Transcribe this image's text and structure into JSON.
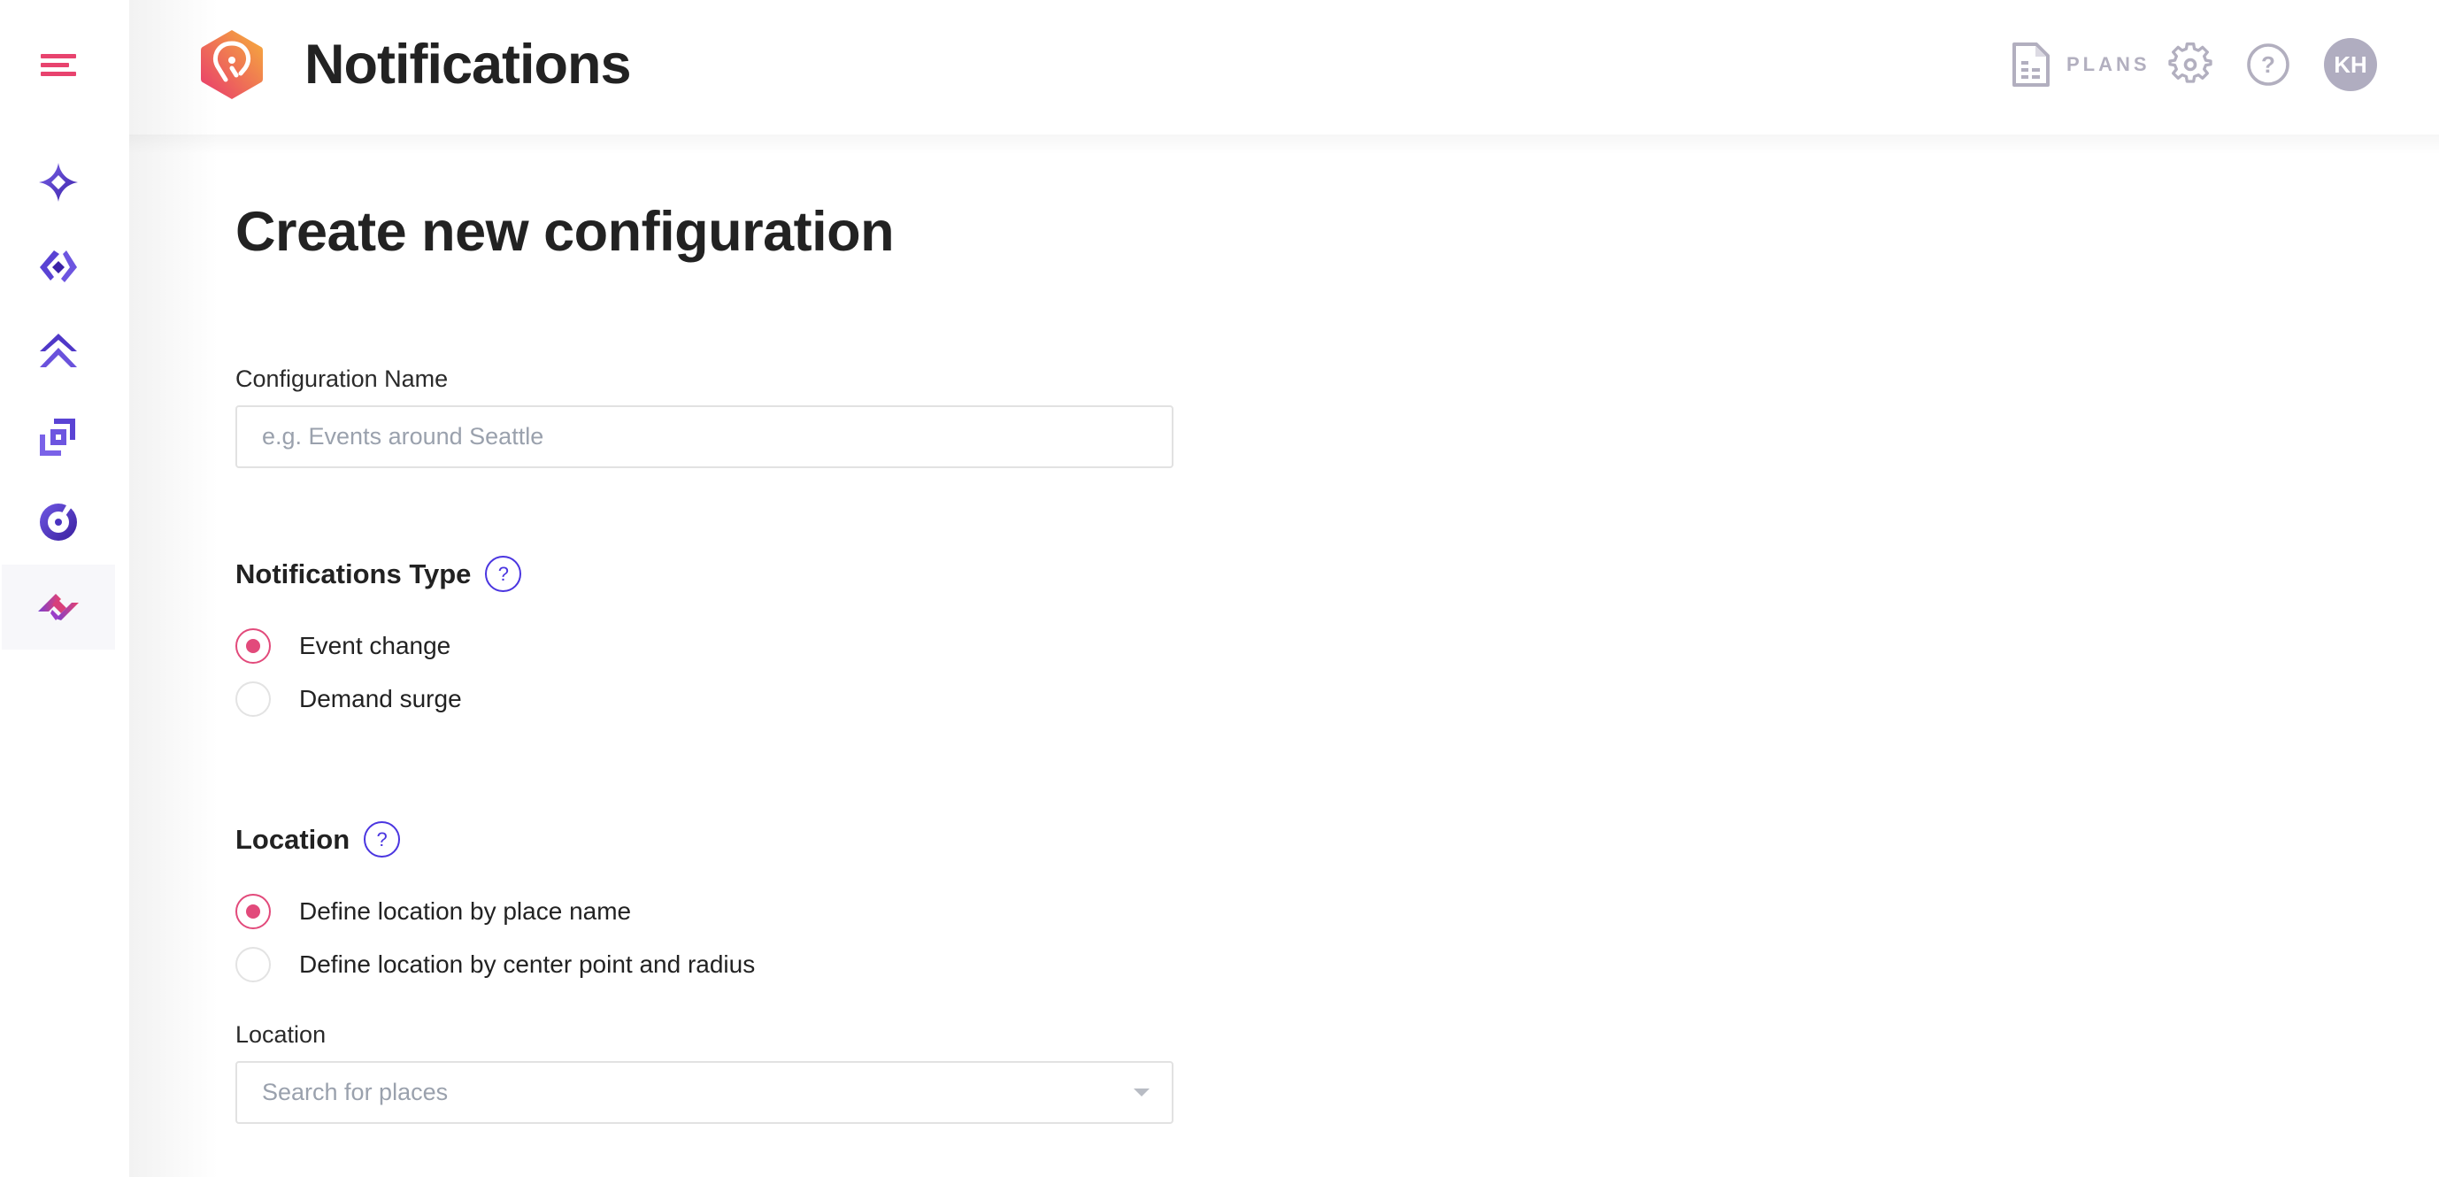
{
  "header": {
    "title": "Notifications",
    "plans_label": "PLANS",
    "avatar_initials": "KH",
    "icons": {
      "logo": "location-pin-hexagon-logo",
      "plans": "document-icon",
      "settings": "gear-icon",
      "help": "help-icon"
    }
  },
  "sidebar": {
    "menu_icon": "hamburger-icon",
    "items": [
      {
        "icon": "sparkle-icon",
        "active": false
      },
      {
        "icon": "diamond-icon",
        "active": false
      },
      {
        "icon": "double-chevron-up-icon",
        "active": false
      },
      {
        "icon": "layers-icon",
        "active": false
      },
      {
        "icon": "target-icon",
        "active": false
      },
      {
        "icon": "notifications-wave-icon",
        "active": true
      }
    ]
  },
  "main": {
    "page_title": "Create new configuration",
    "configuration_name": {
      "label": "Configuration Name",
      "value": "",
      "placeholder": "e.g. Events around Seattle"
    },
    "notifications_type": {
      "title": "Notifications Type",
      "help": "?",
      "options": [
        {
          "label": "Event change",
          "checked": true
        },
        {
          "label": "Demand surge",
          "checked": false
        }
      ]
    },
    "location_section": {
      "title": "Location",
      "help": "?",
      "options": [
        {
          "label": "Define location by place name",
          "checked": true
        },
        {
          "label": "Define location by center point and radius",
          "checked": false
        }
      ],
      "field_label": "Location",
      "select_placeholder": "Search for places"
    }
  },
  "colors": {
    "accent_pink": "#e24a7b",
    "hamburger": "#e8436e",
    "help_blue": "#4a35e0",
    "nav_purple": "#5b45d6",
    "header_icon_gray": "#b2afbf",
    "avatar_bg": "#b0adc0"
  }
}
